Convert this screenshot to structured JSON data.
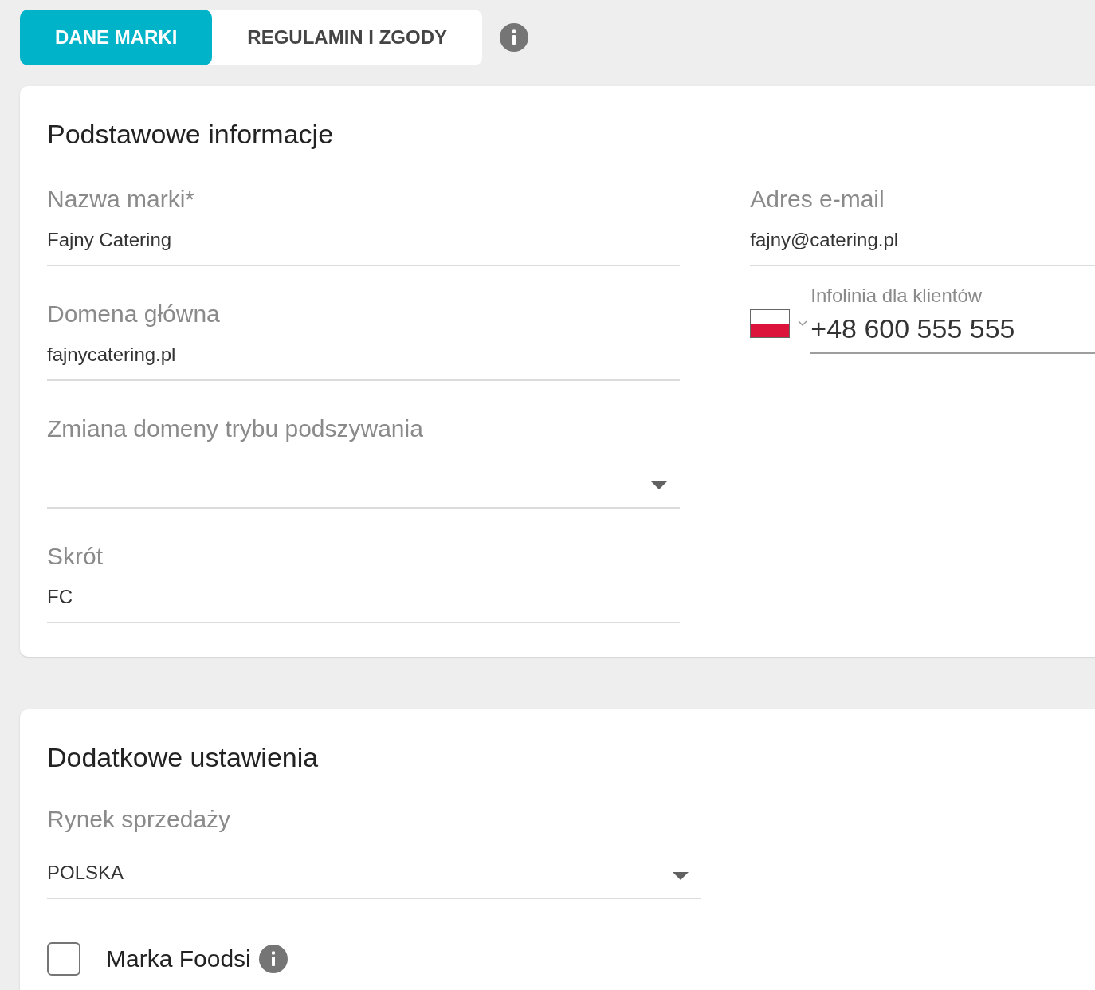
{
  "tabs": [
    {
      "label": "DANE MARKI",
      "selected": true
    },
    {
      "label": "REGULAMIN I ZGODY",
      "selected": false
    }
  ],
  "sections": [
    {
      "title": "Podstawowe informacje",
      "left_fields": [
        {
          "kind": "text",
          "label": "Nazwa marki*",
          "value": "Fajny Catering"
        },
        {
          "kind": "text",
          "label": "Domena główna",
          "value": "fajnycatering.pl"
        },
        {
          "kind": "select",
          "label": "Zmiana domeny trybu podszywania"
        },
        {
          "kind": "text",
          "label": "Skrót",
          "value": "FC"
        }
      ],
      "right_fields": [
        {
          "kind": "text",
          "label": "Adres e-mail",
          "value": "fajny@catering.pl"
        },
        {
          "kind": "phone",
          "label": "Infolinia dla klientów",
          "value": "+48 600 555 555"
        }
      ]
    },
    {
      "title": "Dodatkowe ustawienia",
      "left_fields": [
        {
          "kind": "select",
          "label": "Rynek sprzedaży",
          "value": "POLSKA"
        }
      ],
      "checkbox": {
        "label": "Marka Foodsi",
        "checked": false
      }
    }
  ]
}
